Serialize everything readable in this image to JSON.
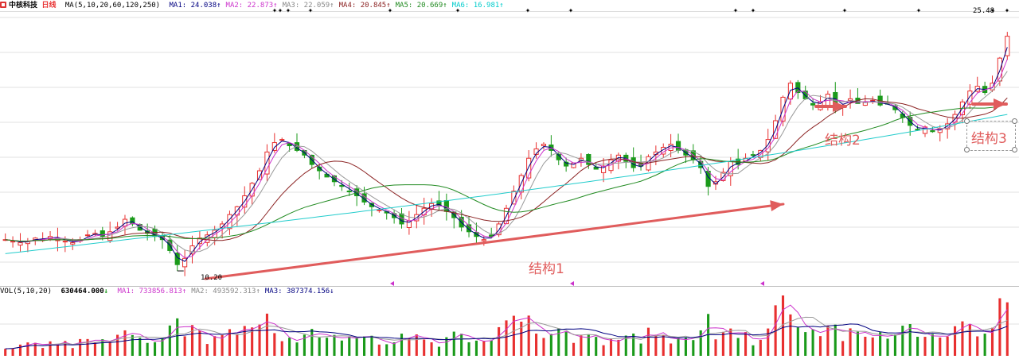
{
  "header": {
    "stock_name": "中核科技",
    "period": "日线",
    "ma_def": "MA(5,10,20,60,120,250)",
    "ma_values": [
      {
        "label": "MA1:",
        "value": "24.038",
        "arrow": "↑",
        "color": "#000080"
      },
      {
        "label": "MA2:",
        "value": "22.873",
        "arrow": "↑",
        "color": "#cc33cc"
      },
      {
        "label": "MA3:",
        "value": "22.059",
        "arrow": "↑",
        "color": "#888888"
      },
      {
        "label": "MA4:",
        "value": "20.845",
        "arrow": "↑",
        "color": "#8b2222"
      },
      {
        "label": "MA5:",
        "value": "20.669",
        "arrow": "↑",
        "color": "#228b22"
      },
      {
        "label": "MA6:",
        "value": "16.981",
        "arrow": "↑",
        "color": "#00cccc"
      }
    ]
  },
  "volume_header": {
    "def": "VOL(5,10,20)",
    "vol": "630464.000",
    "vol_arrow": "↓",
    "ma_values": [
      {
        "label": "MA1:",
        "value": "733856.813",
        "arrow": "↑",
        "color": "#cc33cc"
      },
      {
        "label": "MA2:",
        "value": "493592.313",
        "arrow": "↑",
        "color": "#888888"
      },
      {
        "label": "MA3:",
        "value": "387374.156",
        "arrow": "↓",
        "color": "#000080"
      }
    ]
  },
  "annotations": {
    "structure1": "结构1",
    "structure2": "结构2",
    "structure3": "结构3",
    "low_price": "10.20",
    "high_price": "25.48"
  },
  "colors": {
    "up": "#e83030",
    "down": "#1a9a1a",
    "ma5": "#000080",
    "ma10": "#cc33cc",
    "ma20": "#999999",
    "ma60": "#8b2222",
    "ma120": "#228b22",
    "ma250": "#22cccc",
    "arrow": "#e05c5c",
    "grid": "#e0e0e0"
  },
  "chart_data": {
    "type": "candlestick",
    "y_range": [
      10.0,
      26.5
    ],
    "low": 10.2,
    "high": 25.48,
    "closes": [
      12.2,
      12.1,
      12.0,
      12.1,
      12.3,
      12.2,
      12.4,
      12.3,
      12.1,
      12.0,
      12.2,
      12.5,
      12.6,
      12.4,
      12.7,
      13.0,
      13.5,
      13.2,
      12.8,
      12.6,
      12.4,
      12.2,
      11.5,
      10.6,
      11.0,
      11.8,
      12.3,
      12.5,
      12.8,
      13.2,
      13.8,
      14.3,
      15.0,
      15.8,
      16.6,
      17.8,
      18.4,
      18.6,
      18.2,
      17.9,
      17.6,
      17.0,
      16.6,
      16.2,
      15.9,
      15.6,
      15.3,
      15.0,
      14.6,
      14.3,
      14.1,
      13.9,
      13.6,
      13.2,
      13.4,
      13.8,
      14.2,
      14.5,
      14.4,
      14.0,
      13.6,
      13.0,
      12.7,
      12.4,
      12.2,
      12.4,
      13.2,
      14.2,
      15.3,
      16.3,
      17.4,
      18.0,
      18.3,
      17.9,
      17.3,
      16.9,
      17.1,
      17.4,
      17.0,
      16.7,
      16.9,
      17.3,
      17.6,
      17.2,
      16.8,
      16.9,
      17.5,
      17.8,
      18.1,
      18.3,
      17.9,
      17.6,
      17.3,
      16.8,
      15.6,
      15.9,
      16.5,
      17.2,
      17.0,
      17.4,
      17.6,
      17.9,
      18.6,
      19.8,
      21.3,
      22.2,
      21.6,
      21.2,
      20.8,
      21.0,
      21.5,
      20.9,
      20.8,
      21.2,
      20.9,
      21.0,
      21.1,
      20.8,
      20.9,
      20.5,
      20.0,
      19.5,
      19.2,
      19.4,
      19.1,
      19.3,
      19.6,
      20.2,
      21.0,
      21.7,
      22.0,
      21.6,
      22.2,
      23.8,
      25.2
    ]
  }
}
